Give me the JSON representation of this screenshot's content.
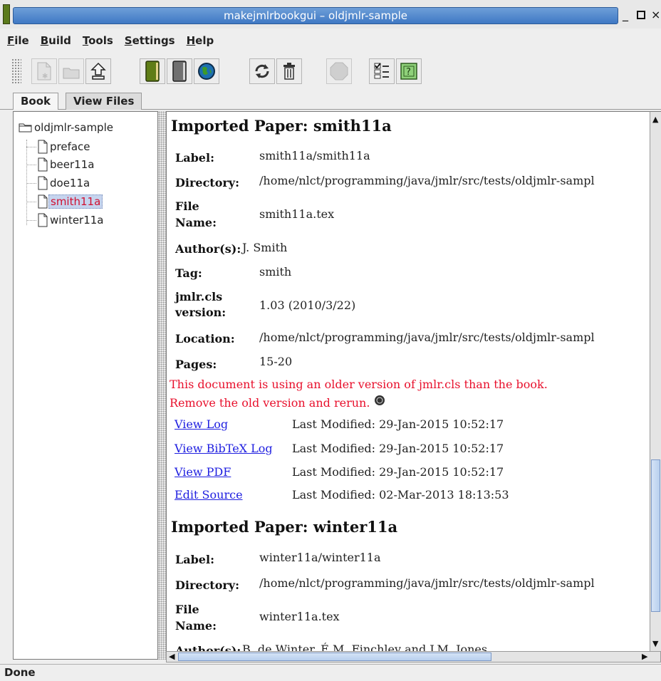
{
  "window": {
    "title": "makejmlrbookgui – oldjmlr-sample"
  },
  "menu": [
    {
      "label": "File",
      "mnemonic": "F",
      "rest": "ile"
    },
    {
      "label": "Build",
      "mnemonic": "B",
      "rest": "uild"
    },
    {
      "label": "Tools",
      "mnemonic": "T",
      "rest": "ools"
    },
    {
      "label": "Settings",
      "mnemonic": "S",
      "rest": "ettings"
    },
    {
      "label": "Help",
      "mnemonic": "H",
      "rest": "elp"
    }
  ],
  "toolbar": {
    "icons": [
      "new-document-icon",
      "open-folder-icon",
      "upload-icon",
      "green-book-icon",
      "grey-book-icon",
      "globe-icon",
      "refresh-icon",
      "trash-icon",
      "stop-icon",
      "checklist-icon",
      "help-icon"
    ]
  },
  "tabs": {
    "book": "Book",
    "view_files": "View Files"
  },
  "tree": {
    "root": "oldjmlr-sample",
    "items": [
      "preface",
      "beer11a",
      "doe11a",
      "smith11a",
      "winter11a"
    ],
    "selected": "smith11a"
  },
  "papers": [
    {
      "heading": "Imported Paper: smith11a",
      "label_label": "Label:",
      "label": "smith11a/smith11a",
      "directory_label": "Directory:",
      "directory": "/home/nlct/programming/java/jmlr/src/tests/oldjmlr-sampl",
      "filename_label_1": "File",
      "filename_label_2": "Name:",
      "filename": "smith11a.tex",
      "authors_label": "Author(s):",
      "authors": "J. Smith",
      "tag_label": "Tag:",
      "tag": "smith",
      "version_label_1": "jmlr.cls",
      "version_label_2": "version:",
      "version": "1.03 (2010/3/22)",
      "location_label": "Location:",
      "location": "/home/nlct/programming/java/jmlr/src/tests/oldjmlr-sampl",
      "pages_label": "Pages:",
      "pages": "15-20",
      "warning_1": "This document is using an older version of jmlr.cls than the book.",
      "warning_2": "Remove the old version and rerun.",
      "links": [
        {
          "label": "View Log",
          "modified": "Last Modified: 29-Jan-2015 10:52:17"
        },
        {
          "label": "View BibTeX Log",
          "modified": "Last Modified: 29-Jan-2015 10:52:17"
        },
        {
          "label": "View PDF",
          "modified": "Last Modified: 29-Jan-2015 10:52:17"
        },
        {
          "label": "Edit Source",
          "modified": "Last Modified: 02-Mar-2013 18:13:53"
        }
      ]
    },
    {
      "heading": "Imported Paper: winter11a",
      "label_label": "Label:",
      "label": "winter11a/winter11a",
      "directory_label": "Directory:",
      "directory": "/home/nlct/programming/java/jmlr/src/tests/oldjmlr-sampl",
      "filename_label_1": "File",
      "filename_label_2": "Name:",
      "filename": "winter11a.tex",
      "authors_label": "Author(s):",
      "authors": "B. de Winter, É.M. Finchley and J.M. Jones"
    }
  ],
  "status": "Done"
}
